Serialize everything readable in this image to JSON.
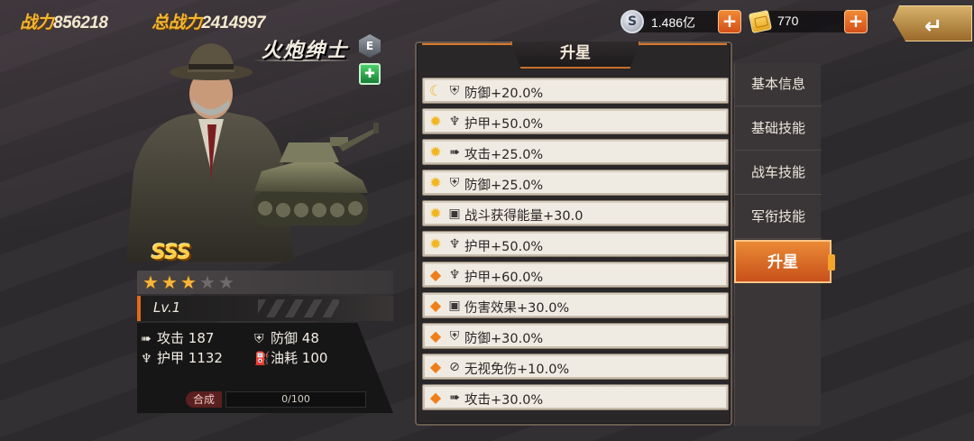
{
  "header": {
    "power_label": "战力",
    "power_value": "856218",
    "total_power_label": "总战力",
    "total_power_value": "2414997"
  },
  "currencies": {
    "silver": {
      "icon": "silver-coin-icon",
      "glyph": "S",
      "value": "1.486亿"
    },
    "gold": {
      "icon": "gold-bar-icon",
      "value": "770"
    },
    "plus_label": "+"
  },
  "back_button": {
    "icon": "back-arrow-icon",
    "glyph": "↵"
  },
  "commander": {
    "name": "火炮绅士",
    "rank_badge": "E",
    "class_badge": "✚",
    "grade": "SSS",
    "stars_filled": 3,
    "stars_total": 5,
    "level": "Lv.1",
    "stats": [
      {
        "icon": "attack-icon",
        "glyph": "➠",
        "label": "攻击",
        "value": "187"
      },
      {
        "icon": "defense-icon",
        "glyph": "⛨",
        "label": "防御",
        "value": "48"
      },
      {
        "icon": "armor-icon",
        "glyph": "♆",
        "label": "护甲",
        "value": "1132"
      },
      {
        "icon": "fuel-icon",
        "glyph": "⛽",
        "label": "油耗",
        "value": "100"
      }
    ],
    "merge_label": "合成",
    "merge_progress": "0/100"
  },
  "upgrade_panel": {
    "title": "升星",
    "effects": [
      {
        "tier": "moon",
        "tier_icon": "moon-tier-icon",
        "tier_glyph": "☾",
        "stat_icon": "defense-icon",
        "stat_glyph": "⛨",
        "text": "防御+20.0%"
      },
      {
        "tier": "sun",
        "tier_icon": "sun-tier-icon",
        "tier_glyph": "✹",
        "stat_icon": "armor-icon",
        "stat_glyph": "♆",
        "text": "护甲+50.0%"
      },
      {
        "tier": "sun",
        "tier_icon": "sun-tier-icon",
        "tier_glyph": "✹",
        "stat_icon": "attack-icon",
        "stat_glyph": "➠",
        "text": "攻击+25.0%"
      },
      {
        "tier": "sun",
        "tier_icon": "sun-tier-icon",
        "tier_glyph": "✹",
        "stat_icon": "defense-icon",
        "stat_glyph": "⛨",
        "text": "防御+25.0%"
      },
      {
        "tier": "sun",
        "tier_icon": "sun-tier-icon",
        "tier_glyph": "✹",
        "stat_icon": "energy-icon",
        "stat_glyph": "▣",
        "text": "战斗获得能量+30.0"
      },
      {
        "tier": "sun",
        "tier_icon": "sun-tier-icon",
        "tier_glyph": "✹",
        "stat_icon": "armor-icon",
        "stat_glyph": "♆",
        "text": "护甲+50.0%"
      },
      {
        "tier": "gem",
        "tier_icon": "gem-tier-icon",
        "tier_glyph": "◆",
        "stat_icon": "armor-icon",
        "stat_glyph": "♆",
        "text": "护甲+60.0%"
      },
      {
        "tier": "gem",
        "tier_icon": "gem-tier-icon",
        "tier_glyph": "◆",
        "stat_icon": "damage-icon",
        "stat_glyph": "▣",
        "text": "伤害效果+30.0%"
      },
      {
        "tier": "gem",
        "tier_icon": "gem-tier-icon",
        "tier_glyph": "◆",
        "stat_icon": "defense-icon",
        "stat_glyph": "⛨",
        "text": "防御+30.0%"
      },
      {
        "tier": "gem",
        "tier_icon": "gem-tier-icon",
        "tier_glyph": "◆",
        "stat_icon": "ignore-damage-icon",
        "stat_glyph": "⊘",
        "text": "无视免伤+10.0%"
      },
      {
        "tier": "gem",
        "tier_icon": "gem-tier-icon",
        "tier_glyph": "◆",
        "stat_icon": "attack-icon",
        "stat_glyph": "➠",
        "text": "攻击+30.0%"
      }
    ]
  },
  "side_tabs": [
    {
      "key": "basic-info",
      "label": "基本信息",
      "active": false
    },
    {
      "key": "basic-skills",
      "label": "基础技能",
      "active": false
    },
    {
      "key": "tank-skills",
      "label": "战车技能",
      "active": false
    },
    {
      "key": "rank-skills",
      "label": "军衔技能",
      "active": false
    },
    {
      "key": "star-up",
      "label": "升星",
      "active": true
    }
  ],
  "colors": {
    "accent_orange": "#e26a1c",
    "gold_text": "#f2b633",
    "panel_row_bg": "#f0ebe2"
  }
}
